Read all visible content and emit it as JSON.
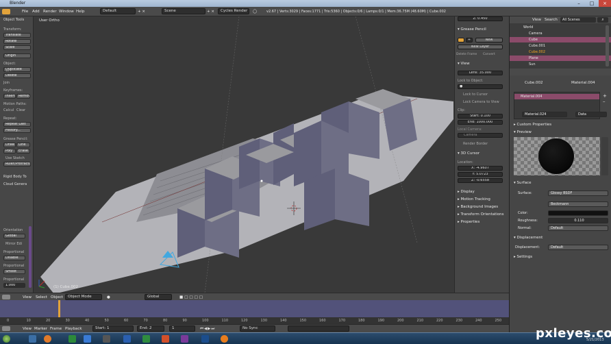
{
  "window": {
    "title": "Blender"
  },
  "topbar": {
    "menus": [
      "File",
      "Add",
      "Render",
      "Window",
      "Help"
    ],
    "layout_screen": "Default",
    "scene": "Scene",
    "engine": "Cycles Render",
    "stats": "v2.67 | Verts:3029 | Faces:1771 | Tris:5360 | Objects:0/6 | Lamps:0/1 | Mem:36.75M (48.60M) | Cube.002"
  },
  "toolshelf": {
    "title": "Object Tools",
    "transform_label": "Transform:",
    "translate": "Translate",
    "rotate": "Rotate",
    "scale": "Scale",
    "origin": "Origin",
    "object_label": "Object:",
    "duplicate": "Duplicate Objec",
    "delete": "Delete",
    "join": "Join",
    "keyframes_label": "Keyframes:",
    "insert": "Insert",
    "remove": "Remov",
    "motion_paths_label": "Motion Paths:",
    "calculate": "Calcul",
    "clear": "Clear",
    "repeat_label": "Repeat:",
    "repeat_last": "Repeat Last",
    "history": "History...",
    "grease_label": "Grease Pencil:",
    "draw": "Draw",
    "line": "Line",
    "poly": "Poly",
    "erase": "Erase",
    "use_sketch": "Use Sketch",
    "ruler": "Ruler/Protractor",
    "rigid_body": "Rigid Body To",
    "cloud": "Cloud Genera",
    "orientation_label": "Orientation",
    "orientation": "Global",
    "mirror": "Mirror Edi",
    "proportional_label": "Proportional",
    "disable": "Disable",
    "proportional_label2": "Proportional",
    "smooth": "Smoot",
    "proportional_label3": "Proportional",
    "prop_size": "1.000"
  },
  "viewport": {
    "view_label": "User Ortho",
    "object_label": "(1) Cube.002"
  },
  "npanel": {
    "z_loc": "Z: 0.450",
    "grease_pencil": "Grease Pencil",
    "new": "New",
    "new_layer": "New Layer",
    "delete_frame": "Delete Frame",
    "convert": "Convert",
    "view": "View",
    "lens": "Lens: 35.000",
    "lock_to_object": "Lock to Object:",
    "lock_to_cursor": "Lock to Cursor",
    "lock_camera": "Lock Camera to View",
    "clip": "Clip:",
    "clip_start": "Start: 0.100",
    "clip_end": "End: 1000.000",
    "local_camera": "Local Camera:",
    "camera": "Camera",
    "render_border": "Render Border",
    "cursor": "3D Cursor",
    "location": "Location:",
    "cx": "X: -4.9607",
    "cy": "Y: 5.0723",
    "cz": "Z: -0.6558",
    "display": "Display",
    "motion_tracking": "Motion Tracking",
    "background_images": "Background Images",
    "transform_orientations": "Transform Orientations",
    "properties": "Properties"
  },
  "outliner": {
    "menu_view": "View",
    "menu_search": "Search",
    "scenes": "All Scenes",
    "items": [
      "World",
      "Camera",
      "Cube",
      "Cube.001",
      "Cube.002",
      "Plane",
      "Sun"
    ]
  },
  "props": {
    "object": "Cube.002",
    "material": "Material.004",
    "slot": "Material.004",
    "mat_name": "Material.024",
    "data": "Data",
    "custom_properties": "Custom Properties",
    "preview": "Preview",
    "surface": "Surface",
    "surface_label": "Surface:",
    "surface_value": "Glossy BSDF",
    "distribution": "Beckmann",
    "color_label": "Color:",
    "roughness_label": "Roughness:",
    "roughness_value": "0.110",
    "normal_label": "Normal:",
    "normal_value": "Default",
    "displacement": "Displacement",
    "displacement_label": "Displacement:",
    "displacement_value": "Default",
    "settings": "Settings"
  },
  "header3d": {
    "menus": [
      "View",
      "Select",
      "Object"
    ],
    "mode": "Object Mode",
    "orientation": "Global"
  },
  "timeline": {
    "ticks": [
      "0",
      "10",
      "20",
      "30",
      "40",
      "50",
      "60",
      "70",
      "80",
      "90",
      "100",
      "110",
      "120",
      "130",
      "140",
      "150",
      "160",
      "170",
      "180",
      "190",
      "200",
      "210",
      "220",
      "230",
      "240",
      "250"
    ],
    "current_frame": 1
  },
  "timeline_header": {
    "menus": [
      "View",
      "Marker",
      "Frame",
      "Playback"
    ],
    "start": "Start: 1",
    "end": "End: 2",
    "frame": "1",
    "sync": "No Sync"
  },
  "taskbar": {
    "date": "5/21/2013"
  },
  "watermark": "pxleyes.com",
  "colors": {
    "accent_orange": "#e2a33b",
    "selected_text": "#f5a623",
    "timeline_purple": "#52527a",
    "material_row": "#8b4b6a"
  }
}
